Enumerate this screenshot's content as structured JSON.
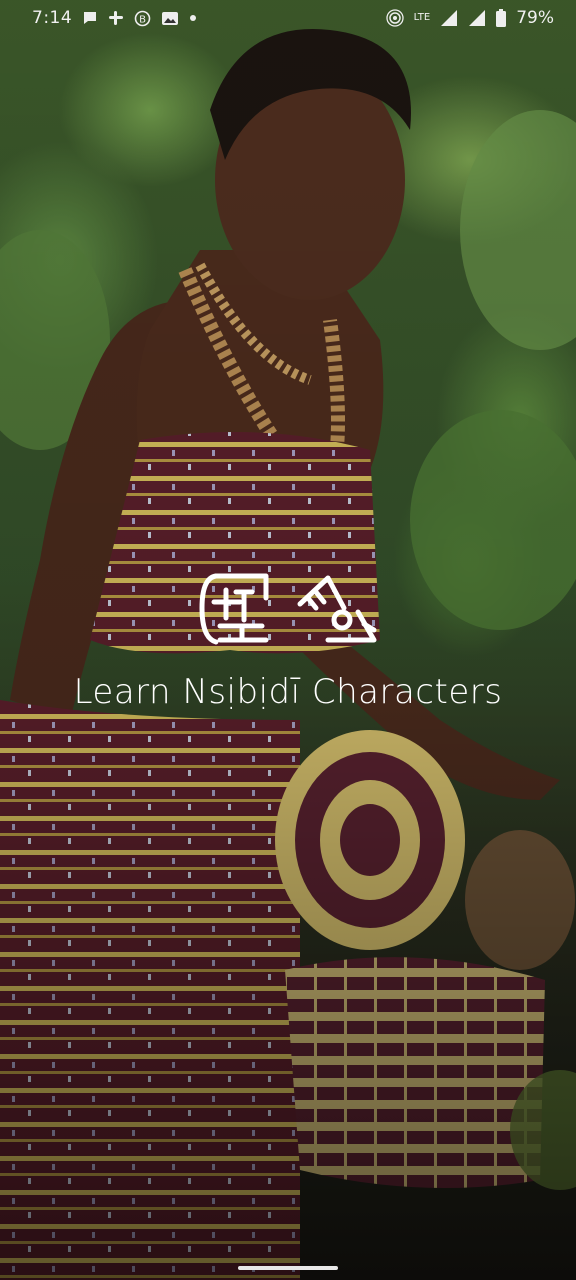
{
  "status_bar": {
    "time": "7:14",
    "network": "LTE",
    "battery": "79%",
    "icons": [
      "message-icon",
      "slack-icon",
      "bitcoin-icon",
      "photo-icon",
      "dot-icon",
      "hotspot-icon",
      "wifi-signal-icon",
      "cell-signal-icon",
      "battery-icon"
    ]
  },
  "splash": {
    "title": "Learn Nsịbịdī Characters",
    "logo": "nsibidi-logo"
  },
  "colors": {
    "title": "#ffffff",
    "foliage": "#5f8c43",
    "cloth": "#5a1f2a",
    "stripe": "#d8c25a"
  }
}
